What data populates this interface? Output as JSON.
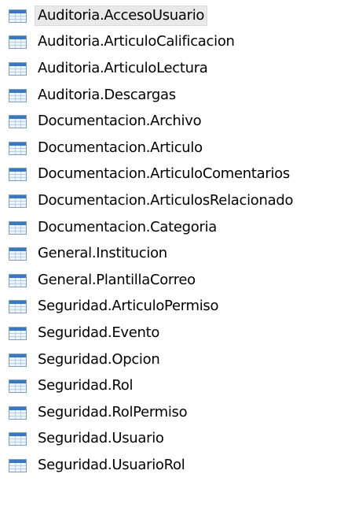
{
  "tree": {
    "items": [
      {
        "label": "Auditoria.AccesoUsuario",
        "selected": true,
        "icon": "table-icon"
      },
      {
        "label": "Auditoria.ArticuloCalificacion",
        "icon": "table-icon"
      },
      {
        "label": "Auditoria.ArticuloLectura",
        "icon": "table-icon"
      },
      {
        "label": "Auditoria.Descargas",
        "icon": "table-icon"
      },
      {
        "label": "Documentacion.Archivo",
        "icon": "table-icon"
      },
      {
        "label": "Documentacion.Articulo",
        "icon": "table-icon"
      },
      {
        "label": "Documentacion.ArticuloComentarios",
        "icon": "table-icon"
      },
      {
        "label": "Documentacion.ArticulosRelacionado",
        "icon": "table-icon"
      },
      {
        "label": "Documentacion.Categoria",
        "icon": "table-icon"
      },
      {
        "label": "General.Institucion",
        "icon": "table-icon"
      },
      {
        "label": "General.PlantillaCorreo",
        "icon": "table-icon"
      },
      {
        "label": "Seguridad.ArticuloPermiso",
        "icon": "table-icon"
      },
      {
        "label": "Seguridad.Evento",
        "icon": "table-icon"
      },
      {
        "label": "Seguridad.Opcion",
        "icon": "table-icon"
      },
      {
        "label": "Seguridad.Rol",
        "icon": "table-icon"
      },
      {
        "label": "Seguridad.RolPermiso",
        "icon": "table-icon"
      },
      {
        "label": "Seguridad.Usuario",
        "icon": "table-icon"
      },
      {
        "label": "Seguridad.UsuarioRol",
        "icon": "table-icon"
      }
    ]
  }
}
